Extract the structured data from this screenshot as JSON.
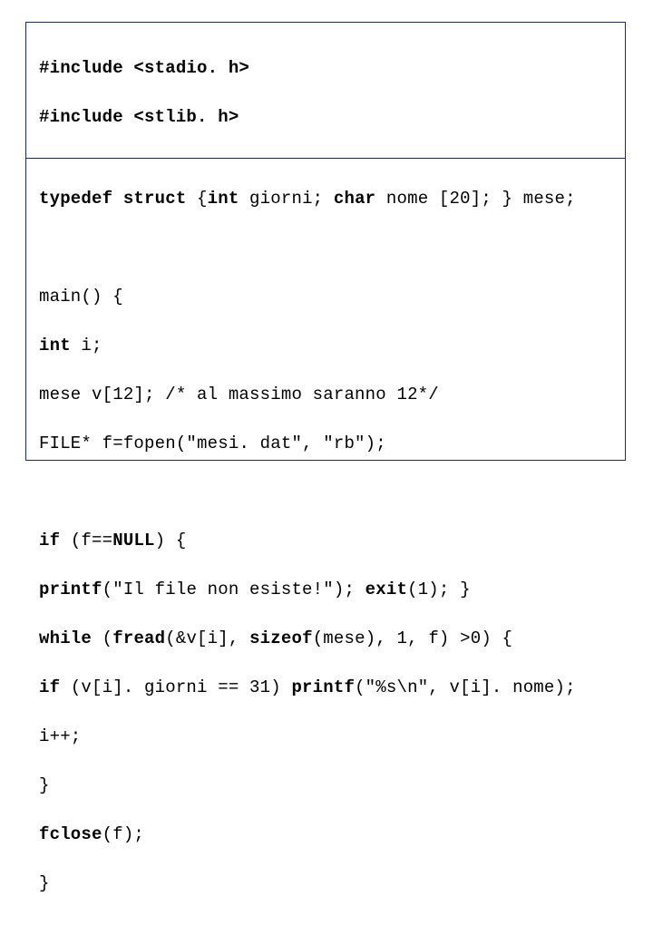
{
  "code": {
    "l1": {
      "a": "#include <stadio. h>"
    },
    "l2": {
      "a": "#include <stlib. h>"
    },
    "l3": {
      "a": "typedef struct ",
      "b": "{",
      "c": "int",
      "d": " giorni; ",
      "e": "char",
      "f": " nome [20]; } mese;"
    },
    "l5": {
      "a": "main() {"
    },
    "l6": {
      "a": "int",
      "b": " i;"
    },
    "l7": {
      "a": "mese v[12]; /* al massimo saranno 12*/"
    },
    "l8": {
      "a": "FILE* f=fopen",
      "b": "(\"mesi. dat\", \"rb\");"
    },
    "l10": {
      "a": "if ",
      "b": "(f==",
      "c": "NULL",
      "d": ") {"
    },
    "l11": {
      "a": "printf",
      "b": "(\"Il file non esiste!\"); ",
      "c": "exit",
      "d": "(1); }"
    },
    "l12": {
      "a": "while ",
      "b": "(",
      "c": "fread",
      "d": "(&v[i], ",
      "e": "sizeof",
      "f": "(mese), 1, f) >0) {"
    },
    "l13": {
      "a": "if ",
      "b": "(v[i]. giorni == 31) ",
      "c": "printf",
      "d": "(\"%s\\n\", v[i]. nome);"
    },
    "l14": {
      "a": "i++;"
    },
    "l15": {
      "a": "}"
    },
    "l16": {
      "a": "fclose",
      "b": "(f);"
    },
    "l17": {
      "a": "}"
    }
  }
}
